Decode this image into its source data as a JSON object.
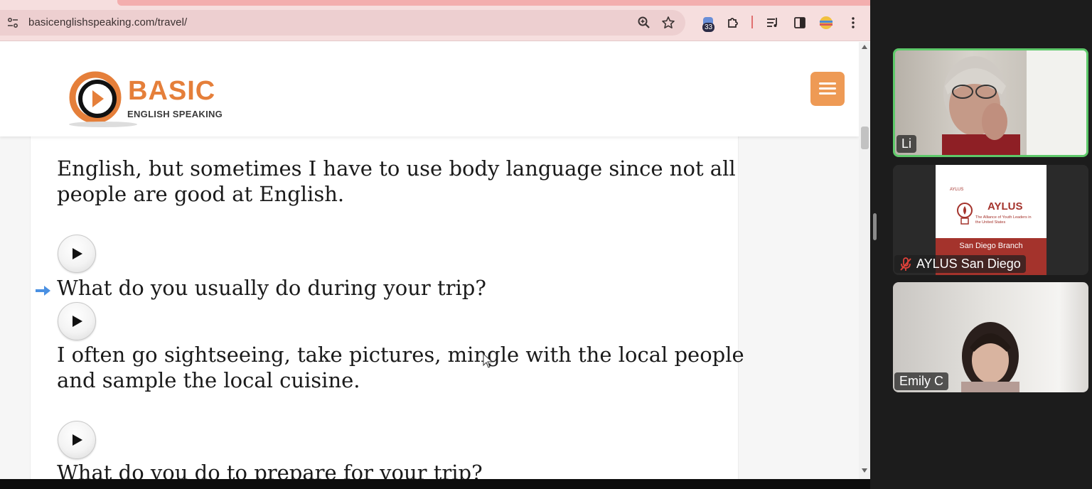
{
  "browser": {
    "url": "basicenglishspeaking.com/travel/",
    "extensions_badge": "33"
  },
  "site": {
    "logo_word": "BASIC",
    "logo_subtitle": "ENGLISH SPEAKING"
  },
  "article": {
    "paragraphs": [
      {
        "line1": "English, but sometimes I have to use body language since not all",
        "line2": "people are good at English."
      },
      {
        "question": "What do you usually do during your trip?"
      },
      {
        "line1": "I often go sightseeing, take pictures, mingle with the local people",
        "line2": "and sample the local cuisine."
      },
      {
        "question": "What do you do to prepare for your trip?"
      }
    ]
  },
  "meeting": {
    "participants": [
      {
        "name": "Li",
        "active_speaker": true
      },
      {
        "name": "AYLUS San Diego",
        "muted": true
      },
      {
        "name": "Emily C"
      }
    ],
    "aylus_slide": {
      "org_small": "AYLUS",
      "title": "AYLUS",
      "subtitle": "The Alliance of Youth Leaders in the United States",
      "branch": "San Diego Branch"
    }
  },
  "colors": {
    "brand_orange": "#e57f3a",
    "active_speaker_border": "#5ec96a",
    "aylus_red": "#a4332c",
    "chrome_tint": "#f6dede"
  }
}
